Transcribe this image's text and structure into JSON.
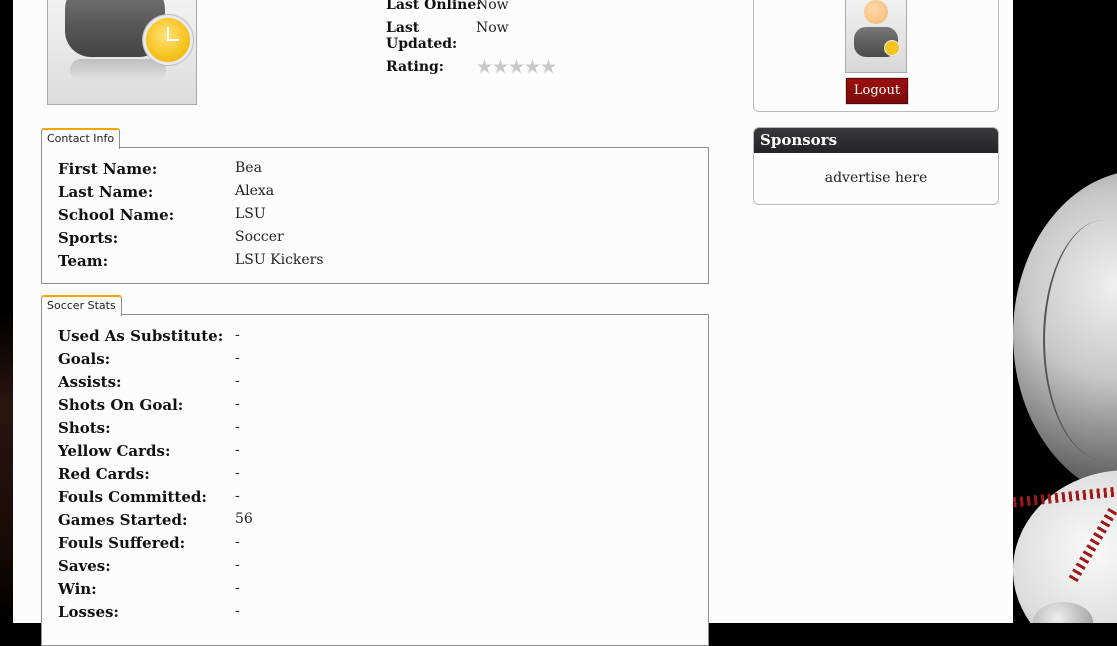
{
  "profile": {
    "last_online_label": "Last Online:",
    "last_online_value": "Now",
    "last_updated_label_1": "Last",
    "last_updated_label_2": "Updated:",
    "last_updated_value": "Now",
    "rating_label": "Rating:",
    "rating_stars": 0,
    "rating_max": 5
  },
  "user_panel": {
    "logout_label": "Logout"
  },
  "sponsors": {
    "title": "Sponsors",
    "body": "advertise here"
  },
  "contact_info": {
    "tab_label": "Contact Info",
    "rows": [
      {
        "label": "First Name:",
        "value": "Bea"
      },
      {
        "label": "Last Name:",
        "value": "Alexa"
      },
      {
        "label": "School Name:",
        "value": "LSU"
      },
      {
        "label": "Sports:",
        "value": "Soccer"
      },
      {
        "label": "Team:",
        "value": "LSU Kickers"
      }
    ]
  },
  "soccer_stats": {
    "tab_label": "Soccer Stats",
    "rows": [
      {
        "label": "Used As Substitute:",
        "value": "-"
      },
      {
        "label": "Goals:",
        "value": "-"
      },
      {
        "label": "Assists:",
        "value": "-"
      },
      {
        "label": "Shots On Goal:",
        "value": "-"
      },
      {
        "label": "Shots:",
        "value": "-"
      },
      {
        "label": "Yellow Cards:",
        "value": "-"
      },
      {
        "label": "Red Cards:",
        "value": "-"
      },
      {
        "label": "Fouls Committed:",
        "value": "-"
      },
      {
        "label": "Games Started:",
        "value": "56"
      },
      {
        "label": "Fouls Suffered:",
        "value": "-"
      },
      {
        "label": "Saves:",
        "value": "-"
      },
      {
        "label": "Win:",
        "value": "-"
      },
      {
        "label": "Losses:",
        "value": "-"
      }
    ]
  }
}
